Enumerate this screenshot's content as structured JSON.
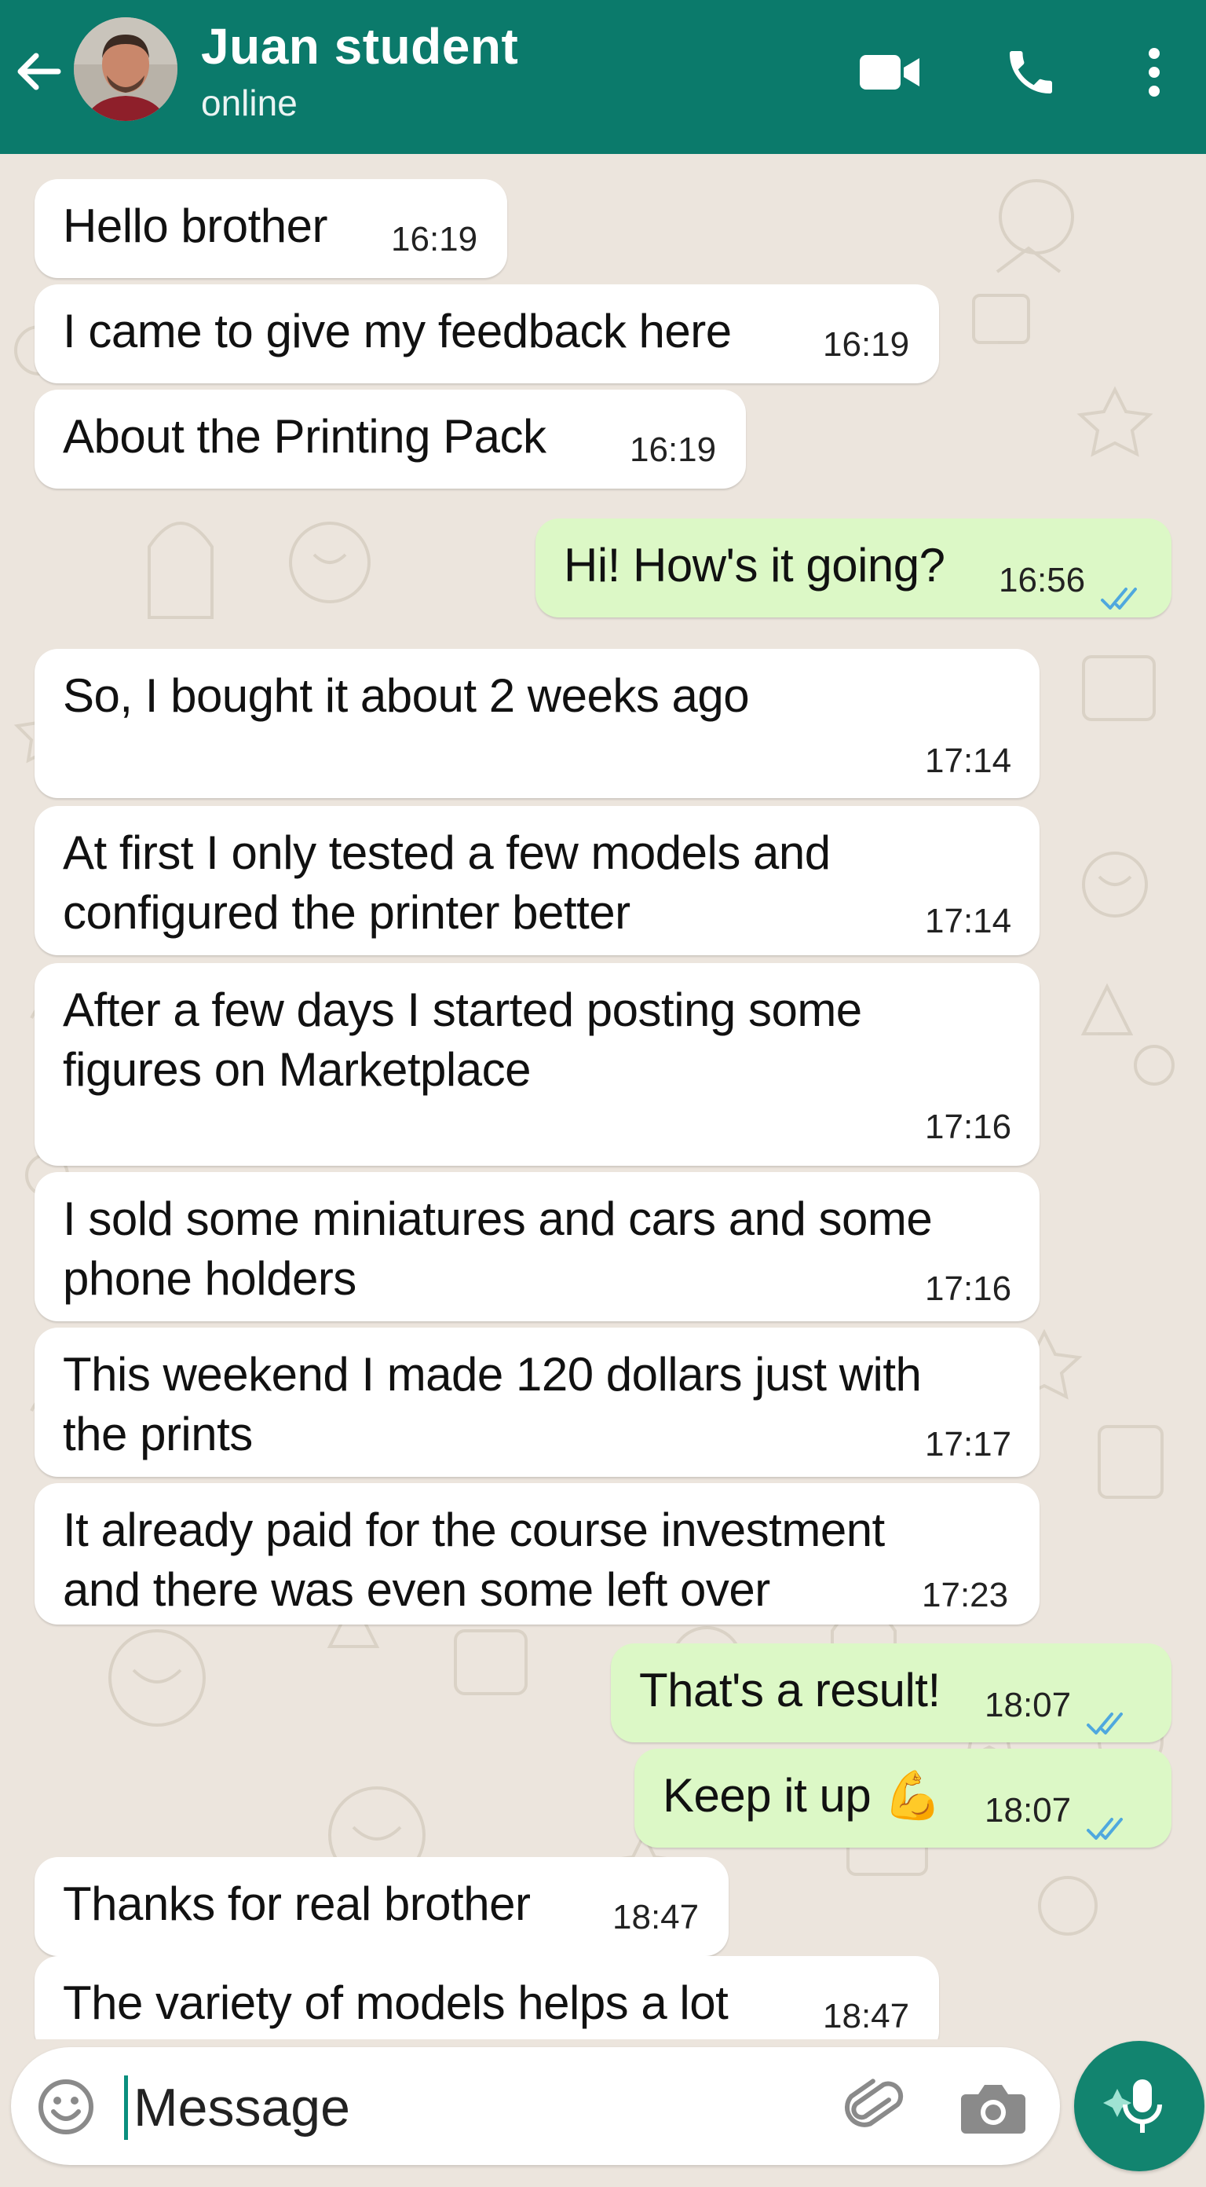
{
  "header": {
    "contact_name": "Juan student",
    "status": "online"
  },
  "colors": {
    "header": "#0b7a6b",
    "outgoing_bubble": "#dcf8c6",
    "incoming_bubble": "#ffffff",
    "chat_background": "#ece5dd",
    "read_ticks": "#4fa8de",
    "mic_button": "#12846f"
  },
  "icons": [
    "back-arrow-icon",
    "video-call-icon",
    "phone-icon",
    "more-options-icon",
    "emoji-icon",
    "attach-icon",
    "camera-icon",
    "mic-icon",
    "double-check-icon"
  ],
  "messages": [
    {
      "direction": "in",
      "text": "Hello brother",
      "time": "16:19"
    },
    {
      "direction": "in",
      "text": "I came to give my feedback here",
      "time": "16:19"
    },
    {
      "direction": "in",
      "text": "About the Printing Pack",
      "time": "16:19"
    },
    {
      "direction": "out",
      "text": "Hi! How's it going?",
      "time": "16:56",
      "status": "read"
    },
    {
      "direction": "in",
      "text": "So, I bought it about 2 weeks ago",
      "time": "17:14"
    },
    {
      "direction": "in",
      "text": "At first I only tested a few models and\nconfigured the printer better",
      "time": "17:14"
    },
    {
      "direction": "in",
      "text": "After a few days I started posting some\nfigures on Marketplace",
      "time": "17:16"
    },
    {
      "direction": "in",
      "text": "I sold some miniatures and cars and some\nphone holders",
      "time": "17:16"
    },
    {
      "direction": "in",
      "text": "This weekend I made 120 dollars just with\nthe prints",
      "time": "17:17"
    },
    {
      "direction": "in",
      "text": "It already paid for the course investment\nand there was even some left over",
      "time": "17:23"
    },
    {
      "direction": "out",
      "text": "That's a result!",
      "time": "18:07",
      "status": "read"
    },
    {
      "direction": "out",
      "text": "Keep it up 💪",
      "time": "18:07",
      "status": "read"
    },
    {
      "direction": "in",
      "text": "Thanks for real brother",
      "time": "18:47"
    },
    {
      "direction": "in",
      "text": "The variety of models helps a lot",
      "time": "18:47"
    }
  ],
  "composer": {
    "placeholder": "Message"
  }
}
